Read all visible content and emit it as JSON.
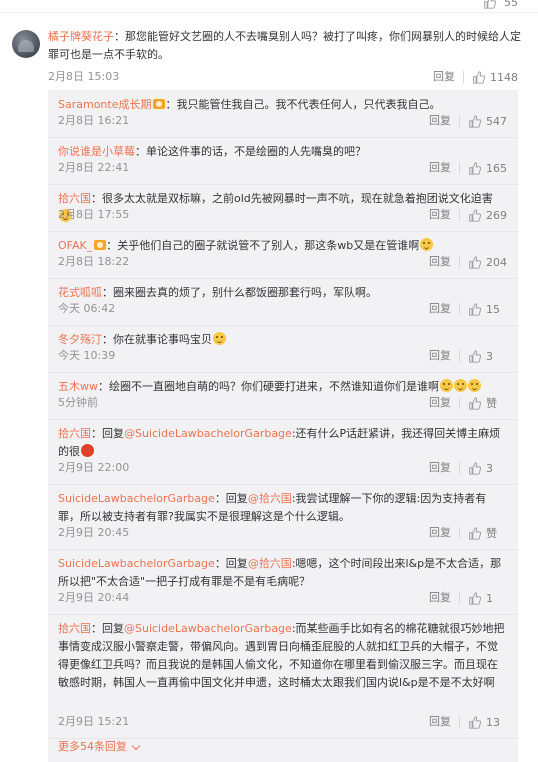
{
  "top_partial": {
    "likes": "55"
  },
  "main": {
    "name": "橘子牌葵花子",
    "text": "：那您能管好文艺圈的人不去嘴臭别人吗？被打了叫疼，你们网暴别人的时候给人定罪可也是一点不手软的。",
    "time": "2月8日 15:03",
    "reply_label": "回复",
    "likes": "1148"
  },
  "replies": [
    {
      "name": "Saramonte成长期",
      "badge": true,
      "text": "：我只能管住我自己。我不代表任何人，只代表我自己。",
      "time": "2月8日 16:21",
      "likes": "547"
    },
    {
      "name": "你说谁是小草莓",
      "text": "：单论这件事的话，不是绘圈的人先嘴臭的吧？",
      "time": "2月8日 22:41",
      "likes": "165"
    },
    {
      "name": "拾六国",
      "text": "：很多太太就是双标嘛，之前old先被网暴时一声不吭，现在就急着抱团说文化迫害",
      "emoji_count": 1,
      "time": "2月8日 17:55",
      "likes": "269"
    },
    {
      "name": "OFAK_",
      "badge": true,
      "text": "：关乎他们自己的圈子就说管不了别人，那这条wb又是在管谁啊",
      "emoji_count": 1,
      "time": "2月8日 18:22",
      "likes": "204"
    },
    {
      "name": "花式呱呱",
      "text": "：圈来圈去真的烦了，别什么都饭圈那套行吗，军队啊。",
      "time": "今天 06:42",
      "likes": "15"
    },
    {
      "name": "冬夕殇汀",
      "text": "：你在就事论事吗宝贝",
      "emoji_count": 1,
      "time": "今天 10:39",
      "likes": "3"
    },
    {
      "name": "五木ww",
      "text": "：绘圈不一直圈地自萌的吗？你们硬要打进来，不然谁知道你们是谁啊",
      "emoji_count": 3,
      "time": "5分钟前",
      "likes": "赞"
    },
    {
      "name": "拾六国",
      "text_pre": "：回复",
      "mention": "@SuicideLawbachelorGarbage",
      "text": ":还有什么P话赶紧讲，我还得回关博主麻烦的很",
      "red_emoji": true,
      "time": "2月9日 22:00",
      "likes": "3"
    },
    {
      "name": "SuicideLawbachelorGarbage",
      "text_pre": "：回复",
      "mention": "@拾六国",
      "text": ":我尝试理解一下你的逻辑:因为支持者有罪，所以被支持者有罪?我属实不是很理解这是个什么逻辑。",
      "time": "2月9日 20:45",
      "likes": "赞"
    },
    {
      "name": "SuicideLawbachelorGarbage",
      "text_pre": "：回复",
      "mention": "@拾六国",
      "text": ":嗯嗯，这个时间段出来l&p是不太合适，那所以把\"不太合适\"一把子打成有罪是不是有毛病呢？",
      "time": "2月9日 20:44",
      "likes": "1"
    },
    {
      "name": "拾六国",
      "text_pre": "：回复",
      "mention": "@SuicideLawbachelorGarbage",
      "text": ":而某些画手比如有名的棉花糖就很巧妙地把事情变成汉服小警察走警，带偏风向。遇到胃日向桶歪屁股的人就扣红卫兵的大帽子，不觉得更像红卫兵吗？而且我说的是韩国人偷文化，不知道你在哪里看到偷汉服三字。而且现在敏感时期，韩国人一直再偷中国文化并申遗，这时桶太太跟我们国内说l&p是不是不太好啊",
      "time": "2月9日 15:21",
      "likes": "13"
    }
  ],
  "reply_label": "回复",
  "more_label": "更多54条回复",
  "colors": {
    "name": "#eb7350",
    "meta": "#939393",
    "reply_bg": "#f2f2f5"
  }
}
